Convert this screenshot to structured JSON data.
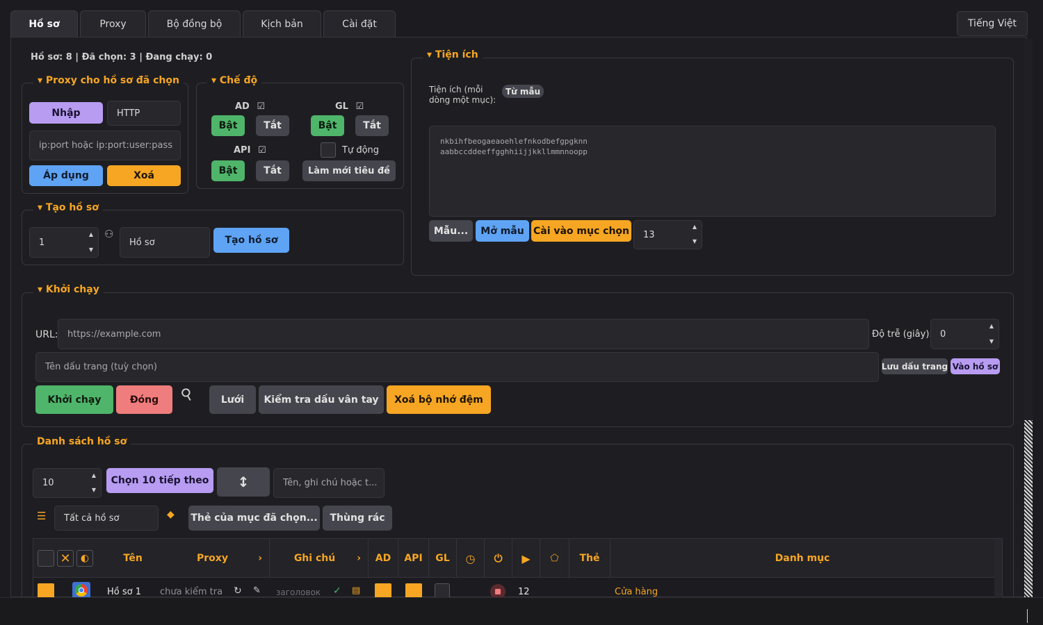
{
  "tabs": [
    "Hồ sơ",
    "Proxy",
    "Bộ đồng bộ",
    "Kịch bản",
    "Cài đặt"
  ],
  "language": "Tiếng Việt",
  "status": "Hồ sơ: 8 | Đã chọn: 3 | Đang chạy: 0",
  "proxy_group": {
    "legend": "Proxy cho hồ sơ đã chọn",
    "import_label": "Nhập",
    "type_value": "HTTP",
    "input_placeholder": "ip:port hoặc ip:port:user:pass",
    "apply_label": "Áp dụng",
    "delete_label": "Xoá"
  },
  "mode_group": {
    "legend": "Chế độ",
    "ad_label": "AD",
    "gl_label": "GL",
    "api_label": "API",
    "on_label": "Bật",
    "off_label": "Tắt",
    "auto_label": "Tự động",
    "refresh_titles_label": "Làm mới tiêu đề"
  },
  "create_group": {
    "legend": "Tạo hồ sơ",
    "count_value": "1",
    "name_value": "Hồ sơ",
    "create_label": "Tạo hồ sơ"
  },
  "extensions_group": {
    "legend": "Tiện ích",
    "description": "Tiện ích (mỗi dòng một mục):",
    "from_template_badge": "Từ mẫu",
    "lines": [
      "nkbihfbeogaeaoehlefnkodbefgpgknn",
      "aabbccddeeffgghhiijjkkllmmnnoopp"
    ],
    "templates_label": "Mẫu...",
    "open_template_label": "Mở mẫu",
    "install_label": "Cài vào mục chọn",
    "count_value": "13"
  },
  "launch_group": {
    "legend": "Khởi chạy",
    "url_label": "URL:",
    "url_placeholder": "https://example.com",
    "delay_label": "Độ trễ (giây):",
    "delay_value": "0",
    "bookmark_placeholder": "Tên dấu trang (tuỳ chọn)",
    "save_bookmark_label": "Lưu dấu trang",
    "enter_profile_label": "Vào hồ sơ",
    "launch_label": "Khởi chạy",
    "close_label": "Đóng",
    "grid_label": "Lưới",
    "fingerprint_label": "Kiểm tra dấu vân tay",
    "clear_cache_label": "Xoá bộ nhớ đệm"
  },
  "profile_list": {
    "legend": "Danh sách hồ sơ",
    "page_size_value": "10",
    "select_next_label": "Chọn 10 tiếp theo",
    "search_placeholder": "Tên, ghi chú hoặc t...",
    "filter_value": "Tất cả hồ sơ",
    "selected_tags_label": "Thẻ của mục đã chọn...",
    "trash_label": "Thùng rác",
    "columns": {
      "name": "Tên",
      "proxy": "Proxy",
      "note": "Ghi chú",
      "ad": "AD",
      "api": "API",
      "gl": "GL",
      "tags": "Thẻ",
      "category": "Danh mục"
    },
    "rows": [
      {
        "name": "Hồ sơ 1",
        "proxy": "chưa kiểm tra",
        "note": "заголовок",
        "count": "12",
        "category": "Cửa hàng"
      }
    ]
  },
  "colors": {
    "accent": "#f6a623",
    "green": "#4fb56a",
    "purple": "#b79cf2",
    "blue": "#5fa3f5",
    "red": "#f07d7d",
    "background": "#1c1c20"
  }
}
